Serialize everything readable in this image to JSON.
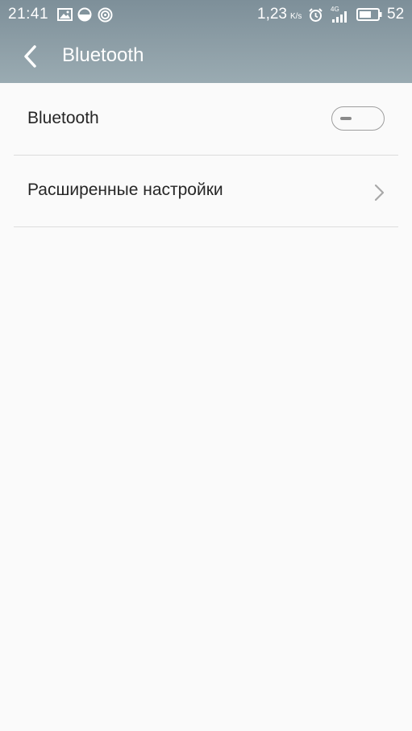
{
  "status_bar": {
    "time": "21:41",
    "net_speed": "1,23",
    "net_speed_unit": "K/s",
    "network_type": "4G",
    "battery_level": "52",
    "icons": [
      "image-icon",
      "data-saver-icon",
      "hotspot-icon",
      "alarm-icon",
      "signal-icon",
      "battery-icon"
    ]
  },
  "header": {
    "title": "Bluetooth",
    "back_icon": "chevron-left-icon"
  },
  "settings": {
    "bluetooth_label": "Bluetooth",
    "bluetooth_enabled": false,
    "advanced_label": "Расширенные настройки",
    "advanced_icon": "chevron-right-icon"
  },
  "colors": {
    "header_background": "#8fa0a8",
    "page_background": "#fafafa",
    "text_primary": "#262626",
    "divider": "#dcdcdc"
  }
}
